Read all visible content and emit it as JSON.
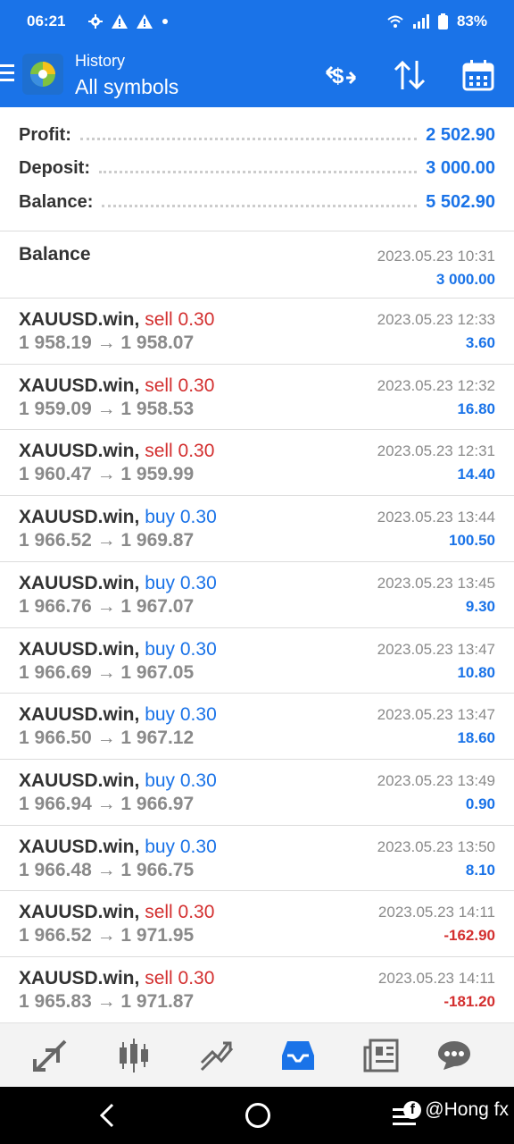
{
  "status_bar": {
    "time": "06:21",
    "battery": "83%"
  },
  "app_bar": {
    "title": "History",
    "subtitle": "All symbols"
  },
  "summary": [
    {
      "label": "Profit:",
      "value": "2 502.90"
    },
    {
      "label": "Deposit:",
      "value": "3 000.00"
    },
    {
      "label": "Balance:",
      "value": "5 502.90"
    }
  ],
  "balance_entry": {
    "title": "Balance",
    "date": "2023.05.23 10:31",
    "amount": "3 000.00"
  },
  "trades": [
    {
      "symbol": "XAUUSD.win,",
      "side": "sell",
      "volume": "sell 0.30",
      "prices": "1 958.19 → 1 958.07",
      "date": "2023.05.23 12:33",
      "profit": "3.60"
    },
    {
      "symbol": "XAUUSD.win,",
      "side": "sell",
      "volume": "sell 0.30",
      "prices": "1 959.09 → 1 958.53",
      "date": "2023.05.23 12:32",
      "profit": "16.80"
    },
    {
      "symbol": "XAUUSD.win,",
      "side": "sell",
      "volume": "sell 0.30",
      "prices": "1 960.47 → 1 959.99",
      "date": "2023.05.23 12:31",
      "profit": "14.40"
    },
    {
      "symbol": "XAUUSD.win,",
      "side": "buy",
      "volume": "buy 0.30",
      "prices": "1 966.52 → 1 969.87",
      "date": "2023.05.23 13:44",
      "profit": "100.50"
    },
    {
      "symbol": "XAUUSD.win,",
      "side": "buy",
      "volume": "buy 0.30",
      "prices": "1 966.76 → 1 967.07",
      "date": "2023.05.23 13:45",
      "profit": "9.30"
    },
    {
      "symbol": "XAUUSD.win,",
      "side": "buy",
      "volume": "buy 0.30",
      "prices": "1 966.69 → 1 967.05",
      "date": "2023.05.23 13:47",
      "profit": "10.80"
    },
    {
      "symbol": "XAUUSD.win,",
      "side": "buy",
      "volume": "buy 0.30",
      "prices": "1 966.50 → 1 967.12",
      "date": "2023.05.23 13:47",
      "profit": "18.60"
    },
    {
      "symbol": "XAUUSD.win,",
      "side": "buy",
      "volume": "buy 0.30",
      "prices": "1 966.94 → 1 966.97",
      "date": "2023.05.23 13:49",
      "profit": "0.90"
    },
    {
      "symbol": "XAUUSD.win,",
      "side": "buy",
      "volume": "buy 0.30",
      "prices": "1 966.48 → 1 966.75",
      "date": "2023.05.23 13:50",
      "profit": "8.10"
    },
    {
      "symbol": "XAUUSD.win,",
      "side": "sell",
      "volume": "sell 0.30",
      "prices": "1 966.52 → 1 971.95",
      "date": "2023.05.23 14:11",
      "profit": "-162.90"
    },
    {
      "symbol": "XAUUSD.win,",
      "side": "sell",
      "volume": "sell 0.30",
      "prices": "1 965.83 → 1 971.87",
      "date": "2023.05.23 14:11",
      "profit": "-181.20"
    }
  ],
  "bottom_tabs": [
    {
      "name": "quotes-icon"
    },
    {
      "name": "chart-icon"
    },
    {
      "name": "trade-icon"
    },
    {
      "name": "history-icon",
      "active": true
    },
    {
      "name": "news-icon"
    },
    {
      "name": "messages-icon"
    }
  ],
  "watermark": {
    "text": "@Hong fx"
  },
  "colors": {
    "primary": "#1a73e8",
    "sell": "#d32f2f",
    "gray": "#8a8a8a"
  }
}
